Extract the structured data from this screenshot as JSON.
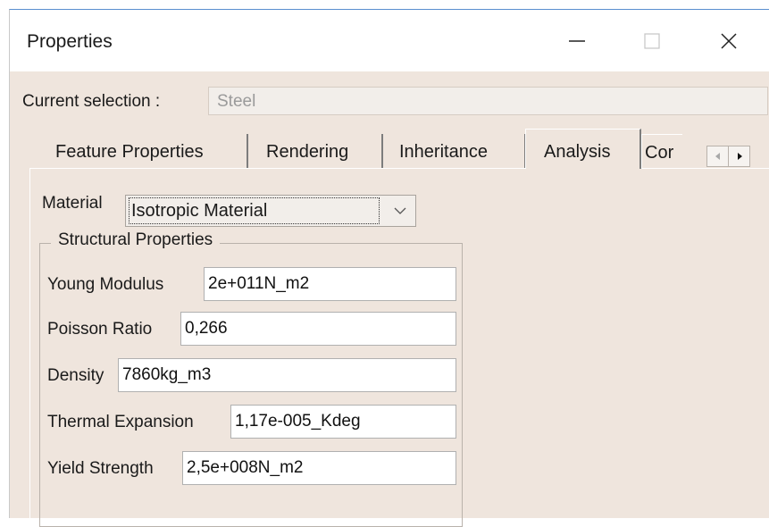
{
  "window": {
    "title": "Properties"
  },
  "selection": {
    "label": "Current selection :",
    "value": "Steel"
  },
  "tabs": [
    {
      "label": "Feature Properties"
    },
    {
      "label": "Rendering"
    },
    {
      "label": "Inheritance"
    },
    {
      "label": "Analysis",
      "active": true
    },
    {
      "label": "Cor"
    }
  ],
  "analysis": {
    "material_label": "Material",
    "material_value": "Isotropic Material",
    "group_title": "Structural Properties",
    "properties": [
      {
        "label": "Young Modulus",
        "value": "2e+011N_m2"
      },
      {
        "label": "Poisson Ratio",
        "value": "0,266"
      },
      {
        "label": "Density",
        "value": "7860kg_m3"
      },
      {
        "label": "Thermal Expansion",
        "value": "1,17e-005_Kdeg"
      },
      {
        "label": "Yield Strength",
        "value": "2,5e+008N_m2"
      }
    ]
  },
  "colors": {
    "client_bg": "#efe5dd",
    "titlebar_bg": "#ffffff",
    "accent_border": "#5a8fcf"
  },
  "icons": [
    "minimize-icon",
    "maximize-icon",
    "close-icon",
    "chevron-down-icon",
    "scroll-left-icon",
    "scroll-right-icon"
  ]
}
